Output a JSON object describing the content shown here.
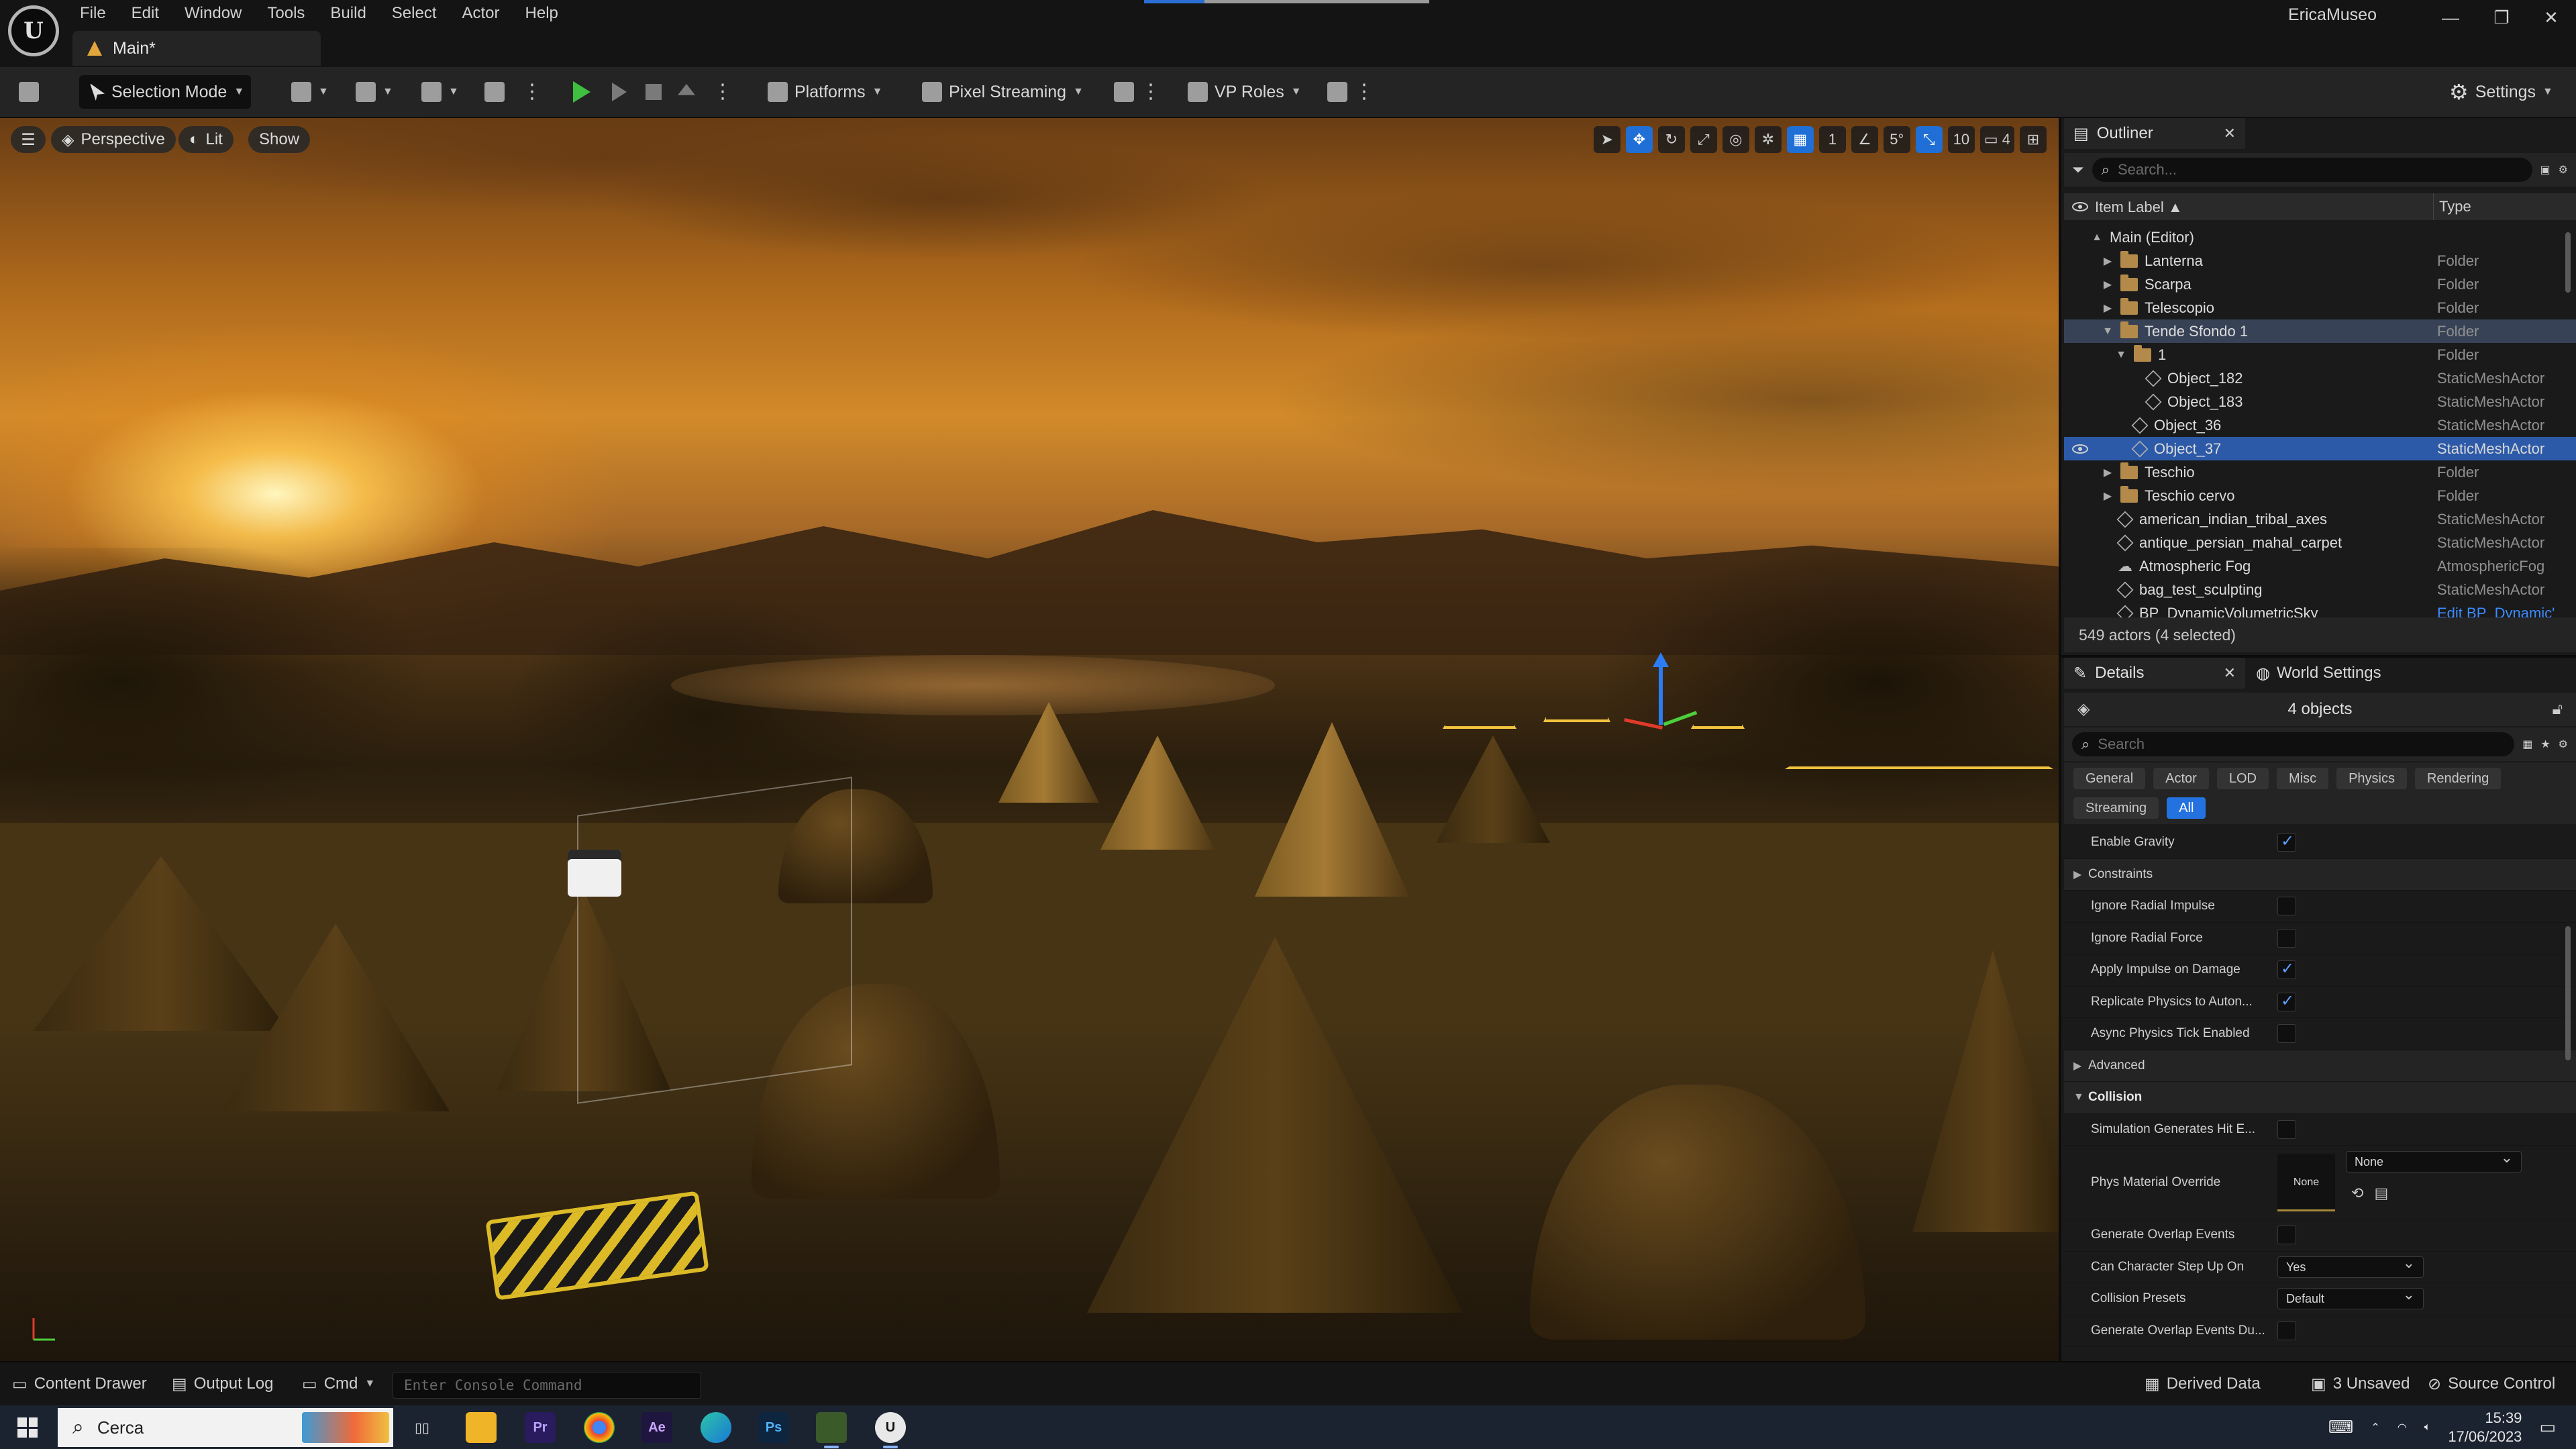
{
  "app": {
    "menu": [
      "File",
      "Edit",
      "Window",
      "Tools",
      "Build",
      "Select",
      "Actor",
      "Help"
    ],
    "tab_title": "Main*",
    "user": "EricaMuseo",
    "window_controls": [
      "—",
      "❐",
      "✕"
    ]
  },
  "toolbar": {
    "selection_mode": "Selection Mode",
    "platforms": "Platforms",
    "pixel_streaming": "Pixel Streaming",
    "vp_roles": "VP Roles",
    "settings": "Settings"
  },
  "viewport": {
    "perspective": "Perspective",
    "lit": "Lit",
    "show": "Show",
    "grid_snap": "1",
    "rotation_snap": "5°",
    "scale_snap": "10",
    "camera_speed": "4"
  },
  "outliner": {
    "tab_label": "Outliner",
    "search_placeholder": "Search...",
    "col_label": "Item Label ▲",
    "col_type": "Type",
    "rows": [
      {
        "label": "Main (Editor)",
        "type": ""
      },
      {
        "label": "Lanterna",
        "type": "Folder"
      },
      {
        "label": "Scarpa",
        "type": "Folder"
      },
      {
        "label": "Telescopio",
        "type": "Folder"
      },
      {
        "label": "Tende Sfondo 1",
        "type": "Folder"
      },
      {
        "label": "1",
        "type": "Folder"
      },
      {
        "label": "Object_182",
        "type": "StaticMeshActor"
      },
      {
        "label": "Object_183",
        "type": "StaticMeshActor"
      },
      {
        "label": "Object_36",
        "type": "StaticMeshActor"
      },
      {
        "label": "Object_37",
        "type": "StaticMeshActor"
      },
      {
        "label": "Teschio",
        "type": "Folder"
      },
      {
        "label": "Teschio cervo",
        "type": "Folder"
      },
      {
        "label": "american_indian_tribal_axes",
        "type": "StaticMeshActor"
      },
      {
        "label": "antique_persian_mahal_carpet",
        "type": "StaticMeshActor"
      },
      {
        "label": "Atmospheric Fog",
        "type": "AtmosphericFog"
      },
      {
        "label": "bag_test_sculpting",
        "type": "StaticMeshActor"
      },
      {
        "label": "BP_DynamicVolumetricSky",
        "type": "Edit BP_Dynamic'"
      }
    ],
    "actor_count": "549 actors (4 selected)"
  },
  "details": {
    "tab_label": "Details",
    "world_settings_label": "World Settings",
    "objects": "4 objects",
    "search_placeholder": "Search",
    "filters": [
      "General",
      "Actor",
      "LOD",
      "Misc",
      "Physics",
      "Rendering",
      "Streaming",
      "All"
    ],
    "properties": [
      {
        "label": "Enable Gravity",
        "kind": "check",
        "checked": true
      },
      {
        "label": "Constraints",
        "kind": "section"
      },
      {
        "label": "Ignore Radial Impulse",
        "kind": "check",
        "checked": false
      },
      {
        "label": "Ignore Radial Force",
        "kind": "check",
        "checked": false
      },
      {
        "label": "Apply Impulse on Damage",
        "kind": "check",
        "checked": true
      },
      {
        "label": "Replicate Physics to Auton...",
        "kind": "check",
        "checked": true
      },
      {
        "label": "Async Physics Tick Enabled",
        "kind": "check",
        "checked": false
      },
      {
        "label": "Advanced",
        "kind": "section"
      },
      {
        "label": "Collision",
        "kind": "section-open"
      },
      {
        "label": "Simulation Generates Hit E...",
        "kind": "check",
        "checked": false
      },
      {
        "label": "Phys Material Override",
        "kind": "material",
        "thumb": "None",
        "value": "None"
      },
      {
        "label": "Generate Overlap Events",
        "kind": "check",
        "checked": false
      },
      {
        "label": "Can Character Step Up On",
        "kind": "dropdown",
        "value": "Yes"
      },
      {
        "label": "Collision Presets",
        "kind": "dropdown",
        "value": "Default"
      },
      {
        "label": "Generate Overlap Events Du...",
        "kind": "check",
        "checked": false
      }
    ]
  },
  "statusbar": {
    "content_drawer": "Content Drawer",
    "output_log": "Output Log",
    "cmd": "Cmd",
    "console_placeholder": "Enter Console Command",
    "derived_data": "Derived Data",
    "unsaved": "3 Unsaved",
    "source_control": "Source Control"
  },
  "taskbar": {
    "search_label": "Cerca",
    "apps": [
      "Task View",
      "File Explorer",
      "Premiere Pro",
      "Chrome",
      "After Effects",
      "Edge",
      "Photoshop",
      "Game",
      "Unreal Engine"
    ],
    "time": "15:39",
    "date": "17/06/2023"
  }
}
